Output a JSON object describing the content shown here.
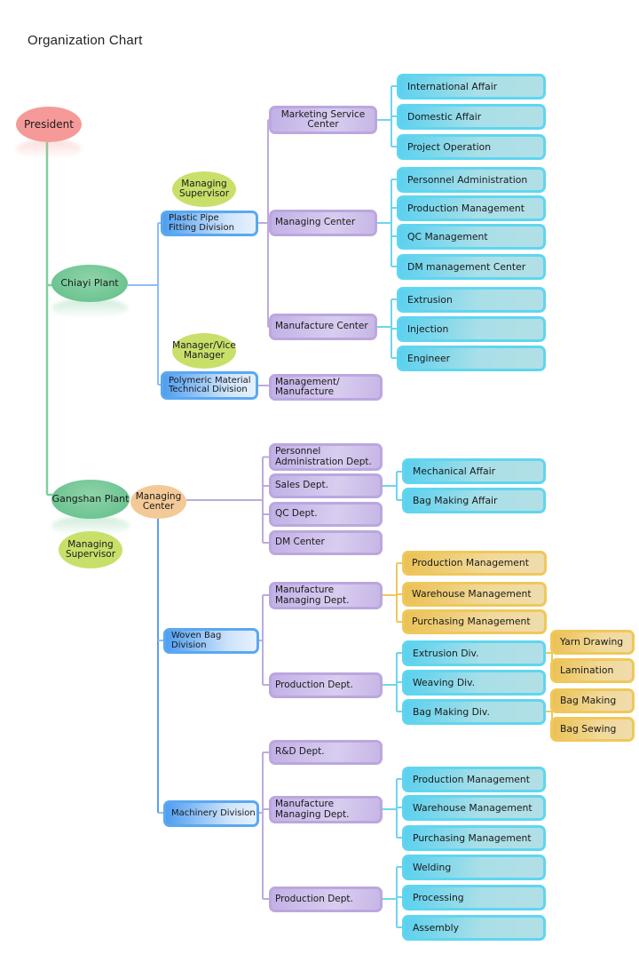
{
  "title": "Organization Chart",
  "colors": {
    "trunk_line": "#7fcf9c",
    "division_line": "#8fbdf5",
    "dept_line": "#bcabdf",
    "cyan_line": "#6fd5ee",
    "gold_line": "#f0c85a",
    "managing_center_line": "#5a9ef2"
  },
  "president": "President",
  "chiayi": {
    "plant": "Chiayi  Plant",
    "divisions": [
      {
        "name": "Plastic Pipe\nFitting Division",
        "head": "Managing\nSupervisor",
        "centers": [
          {
            "name": "Marketing Service\nCenter",
            "units": [
              "International Affair",
              "Domestic Affair",
              "Project Operation"
            ]
          },
          {
            "name": "Managing Center",
            "units": [
              "Personnel Administration",
              "Production Management",
              "QC Management",
              "DM management Center"
            ]
          },
          {
            "name": "Manufacture Center",
            "units": [
              "Extrusion",
              "Injection",
              "Engineer"
            ]
          }
        ]
      },
      {
        "name": "Polymeric Material\nTechnical Division",
        "head": "Manager/Vice\nManager",
        "centers": [
          {
            "name": "Management/\nManufacture",
            "units": []
          }
        ]
      }
    ]
  },
  "gangshan": {
    "plant": "Gangshan  Plant",
    "head": "Managing\nSupervisor",
    "managing_center": "Managing\nCenter",
    "depts": [
      {
        "name": "Personnel\nAdministration Dept.",
        "units": []
      },
      {
        "name": "Sales Dept.",
        "units": [
          "Mechanical Affair",
          "Bag Making Affair"
        ]
      },
      {
        "name": "QC Dept.",
        "units": []
      },
      {
        "name": "DM Center",
        "units": []
      }
    ],
    "woven": {
      "name": "Woven Bag Division",
      "manufacture_dept": "Manufacture\nManaging Dept.",
      "manufacture_units": [
        "Production Management",
        "Warehouse Management",
        "Purchasing Management"
      ],
      "production_dept": "Production Dept.",
      "production_divs": [
        {
          "name": "Extrusion Div.",
          "subs": [
            "Yarn Drawing",
            "Lamination"
          ]
        },
        {
          "name": "Weaving Div.",
          "subs": []
        },
        {
          "name": "Bag Making Div.",
          "subs": [
            "Bag Making",
            "Bag Sewing"
          ]
        }
      ]
    },
    "machinery": {
      "name": "Machinery Division",
      "rd_dept": "R&D Dept.",
      "manufacture_dept": "Manufacture\nManaging Dept.",
      "manufacture_units": [
        "Production Management",
        "Warehouse Management",
        "Purchasing Management"
      ],
      "production_dept": "Production Dept.",
      "production_units": [
        "Welding",
        "Processing",
        "Assembly"
      ]
    }
  }
}
